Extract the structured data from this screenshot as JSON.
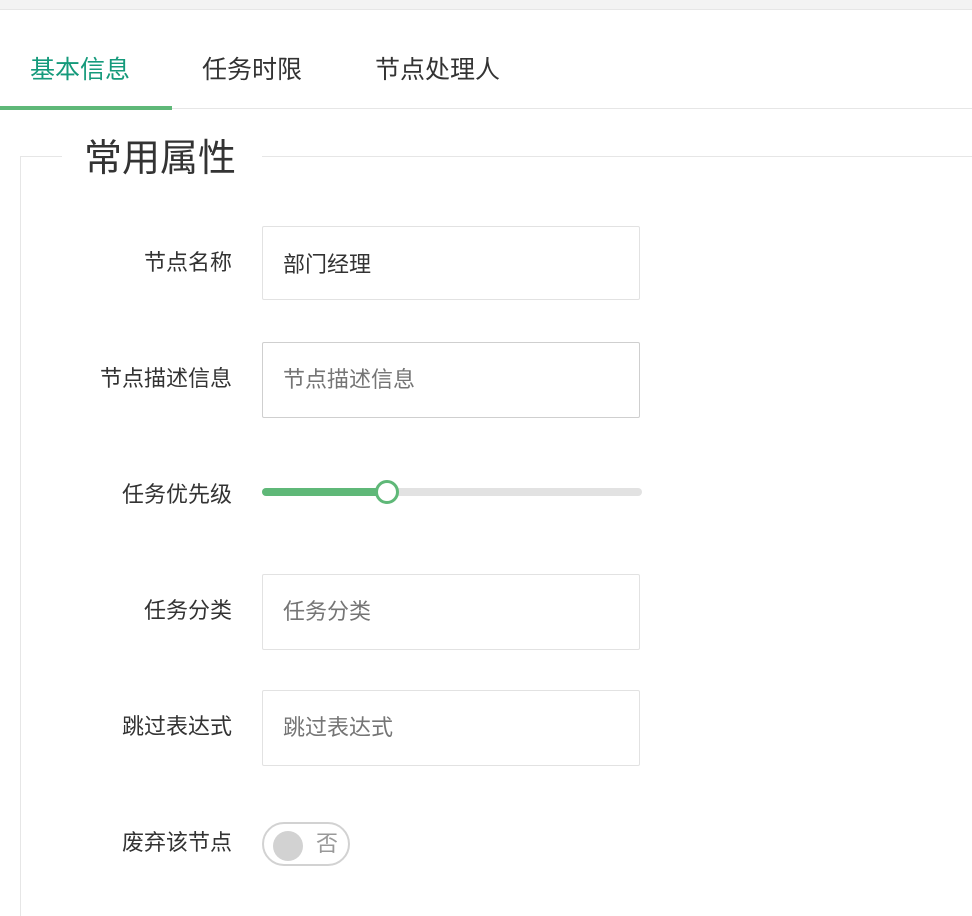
{
  "tabs": [
    {
      "label": "基本信息",
      "active": true
    },
    {
      "label": "任务时限",
      "active": false
    },
    {
      "label": "节点处理人",
      "active": false
    }
  ],
  "section": {
    "legend": "常用属性"
  },
  "fields": {
    "node_name": {
      "label": "节点名称",
      "value": "部门经理"
    },
    "node_description": {
      "label": "节点描述信息",
      "placeholder": "节点描述信息"
    },
    "task_priority": {
      "label": "任务优先级",
      "value_fraction": 0.33
    },
    "task_category": {
      "label": "任务分类",
      "placeholder": "任务分类"
    },
    "skip_expression": {
      "label": "跳过表达式",
      "placeholder": "跳过表达式"
    },
    "discard_node": {
      "label": "废弃该节点",
      "state_text": "否",
      "on": false
    }
  },
  "colors": {
    "accent": "#159a7b",
    "green": "#5fb878",
    "border": "#e2e2e2"
  }
}
